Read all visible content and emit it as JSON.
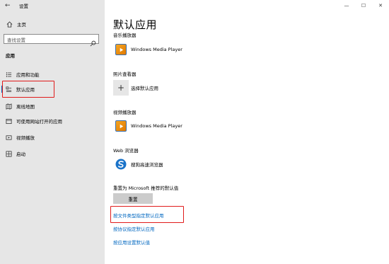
{
  "window": {
    "title": "设置",
    "back_glyph": "←",
    "minimize_glyph": "—",
    "maximize_glyph": "☐",
    "close_glyph": "✕"
  },
  "sidebar": {
    "home_label": "主页",
    "search_placeholder": "查找设置",
    "section_title": "应用",
    "items": [
      {
        "label": "应用和功能",
        "icon": "apps-list-icon"
      },
      {
        "label": "默认应用",
        "icon": "default-apps-icon",
        "selected": true
      },
      {
        "label": "离线地图",
        "icon": "offline-map-icon"
      },
      {
        "label": "可使用网站打开的应用",
        "icon": "apps-for-websites-icon"
      },
      {
        "label": "视频播放",
        "icon": "video-playback-icon"
      },
      {
        "label": "启动",
        "icon": "startup-icon"
      }
    ]
  },
  "main": {
    "title": "默认应用",
    "categories": [
      {
        "label": "音乐播放器",
        "app": "Windows Media Player"
      },
      {
        "label": "照片查看器",
        "app": "选择默认应用"
      },
      {
        "label": "视频播放器",
        "app": "Windows Media Player"
      },
      {
        "label": "Web 浏览器",
        "app": "搜狗高速浏览器"
      }
    ],
    "reset_label": "重置为 Microsoft 推荐的默认值",
    "reset_button": "重置",
    "links": [
      "按文件类型指定默认应用",
      "按协议指定默认应用",
      "按应用设置默认值"
    ]
  },
  "colors": {
    "accent": "#0067c0",
    "highlight_box": "#e01b1b",
    "sidebar_bg": "#e6e6e6"
  }
}
